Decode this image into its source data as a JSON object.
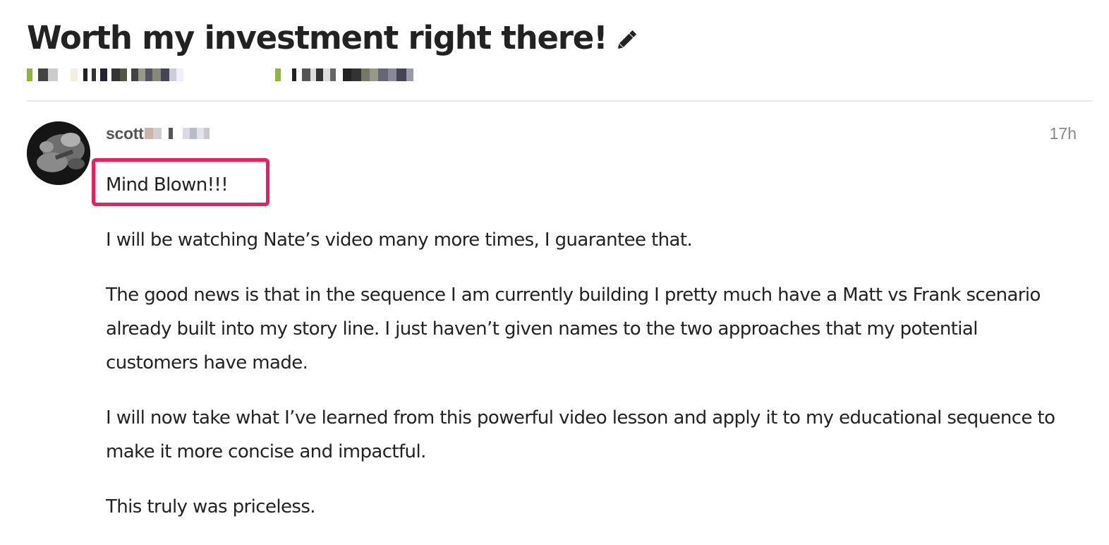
{
  "topic": {
    "title": "Worth my investment right there!",
    "edit_icon": "pencil-icon",
    "categories": [
      {
        "swatch_color": "#8fb43a",
        "name_redacted": true
      },
      {
        "swatch_color": "#8fb43a",
        "name_redacted": true
      }
    ]
  },
  "post": {
    "username_visible": "scott",
    "username_redacted": true,
    "time": "17h",
    "avatar": "user-avatar-image",
    "paragraphs": [
      "Mind Blown!!!",
      "I will be watching Nate’s video many more times, I guarantee that.",
      "The good news is that in the sequence I am currently building I pretty much have a Matt vs Frank scenario already built into my story line. I just haven’t given names to the two approaches that my potential customers have made.",
      "I will now take what I’ve learned from this powerful video lesson and apply it to my educational sequence to make it more concise and impactful.",
      "This truly was priceless."
    ]
  },
  "annotation": {
    "highlight_color": "#f31b5e"
  }
}
